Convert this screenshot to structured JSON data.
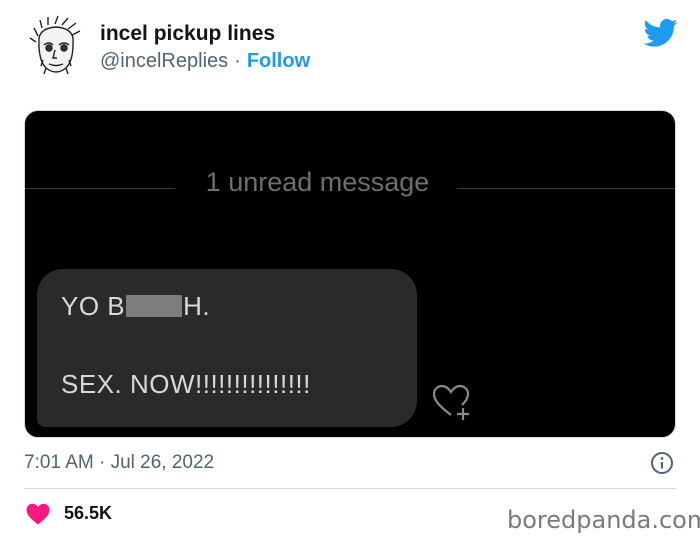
{
  "tweet": {
    "author_name": "incel pickup lines",
    "handle": "@incelReplies",
    "separator": "·",
    "follow_label": "Follow",
    "timestamp": "7:01 AM · Jul 26, 2022",
    "likes": "56.5K"
  },
  "media": {
    "unread_label": "1 unread message",
    "line1_before": "YO B",
    "line1_after": "H.",
    "line2": "SEX. NOW!!!!!!!!!!!!!!!"
  },
  "watermark": "boredpanda.com",
  "colors": {
    "accent": "#1d9bf0",
    "heart": "#f91880",
    "media_bg": "#000000",
    "bubble": "#2a2a2a"
  },
  "icons": [
    "avatar-sketch",
    "twitter-bird-icon",
    "heart-plus-icon",
    "info-icon",
    "heart-icon"
  ]
}
